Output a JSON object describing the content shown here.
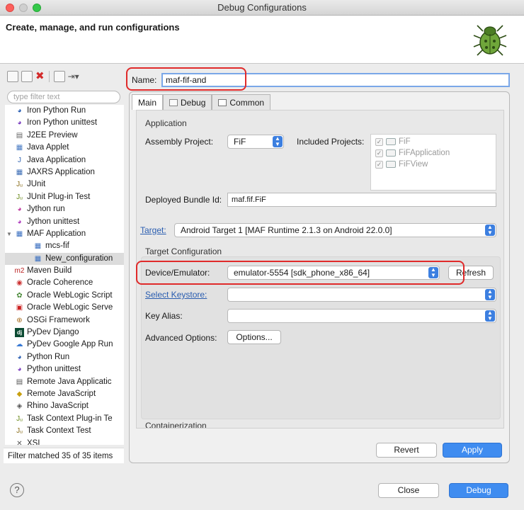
{
  "window": {
    "title": "Debug Configurations"
  },
  "banner": {
    "title": "Create, manage, and run configurations"
  },
  "filter": {
    "placeholder": "type filter text"
  },
  "tree": [
    {
      "label": "Iron Python Run",
      "indent": 0,
      "icon": "python-run-icon"
    },
    {
      "label": "Iron Python unittest",
      "indent": 0,
      "icon": "python-unittest-icon"
    },
    {
      "label": "J2EE Preview",
      "indent": 0,
      "icon": "j2ee-icon"
    },
    {
      "label": "Java Applet",
      "indent": 0,
      "icon": "applet-icon"
    },
    {
      "label": "Java Application",
      "indent": 0,
      "icon": "java-app-icon"
    },
    {
      "label": "JAXRS Application",
      "indent": 0,
      "icon": "jaxrs-icon"
    },
    {
      "label": "JUnit",
      "indent": 0,
      "icon": "junit-icon"
    },
    {
      "label": "JUnit Plug-in Test",
      "indent": 0,
      "icon": "junit-plugin-icon"
    },
    {
      "label": "Jython run",
      "indent": 0,
      "icon": "jython-run-icon"
    },
    {
      "label": "Jython unittest",
      "indent": 0,
      "icon": "jython-unittest-icon"
    },
    {
      "label": "MAF Application",
      "indent": 0,
      "icon": "maf-icon",
      "expanded": true
    },
    {
      "label": "mcs-fif",
      "indent": 1,
      "icon": "maf-config-icon"
    },
    {
      "label": "New_configuration",
      "indent": 1,
      "icon": "maf-config-icon",
      "selected": true
    },
    {
      "label": "Maven Build",
      "indent": 0,
      "icon": "maven-icon"
    },
    {
      "label": "Oracle Coherence",
      "indent": 0,
      "icon": "coherence-icon"
    },
    {
      "label": "Oracle WebLogic Script",
      "indent": 0,
      "icon": "weblogic-script-icon"
    },
    {
      "label": "Oracle WebLogic Serve",
      "indent": 0,
      "icon": "weblogic-server-icon"
    },
    {
      "label": "OSGi Framework",
      "indent": 0,
      "icon": "osgi-icon"
    },
    {
      "label": "PyDev Django",
      "indent": 0,
      "icon": "django-icon"
    },
    {
      "label": "PyDev Google App Run",
      "indent": 0,
      "icon": "google-app-icon"
    },
    {
      "label": "Python Run",
      "indent": 0,
      "icon": "python-run-icon"
    },
    {
      "label": "Python unittest",
      "indent": 0,
      "icon": "python-unittest-icon"
    },
    {
      "label": "Remote Java Applicatic",
      "indent": 0,
      "icon": "remote-java-icon"
    },
    {
      "label": "Remote JavaScript",
      "indent": 0,
      "icon": "remote-js-icon"
    },
    {
      "label": "Rhino JavaScript",
      "indent": 0,
      "icon": "rhino-icon"
    },
    {
      "label": "Task Context Plug-in Te",
      "indent": 0,
      "icon": "task-plugin-icon"
    },
    {
      "label": "Task Context Test",
      "indent": 0,
      "icon": "task-test-icon"
    },
    {
      "label": "XSL",
      "indent": 0,
      "icon": "xsl-icon"
    }
  ],
  "filter_status": "Filter matched 35 of 35 items",
  "name": {
    "label": "Name:",
    "value": "maf-fif-and"
  },
  "tabs": [
    {
      "label": "Main",
      "active": true
    },
    {
      "label": "Debug"
    },
    {
      "label": "Common"
    }
  ],
  "application": {
    "section": "Application",
    "assembly_label": "Assembly Project:",
    "assembly_value": "FiF",
    "included_label": "Included Projects:",
    "included": [
      "FiF",
      "FiFApplication",
      "FiFView"
    ],
    "bundle_label": "Deployed Bundle Id:",
    "bundle_value": "maf.fif.FiF"
  },
  "target": {
    "link": "Target:",
    "value": "Android Target 1 [MAF Runtime 2.1.3 on Android 22.0.0]"
  },
  "target_config": {
    "section": "Target Configuration",
    "device_label": "Device/Emulator:",
    "device_value": "emulator-5554 [sdk_phone_x86_64]",
    "refresh": "Refresh",
    "keystore_link": "Select Keystore:",
    "key_alias_label": "Key Alias:",
    "advanced_label": "Advanced Options:",
    "options_button": "Options..."
  },
  "containerization": "Containerization",
  "buttons": {
    "revert": "Revert",
    "apply": "Apply",
    "close": "Close",
    "debug": "Debug"
  },
  "help": "?"
}
